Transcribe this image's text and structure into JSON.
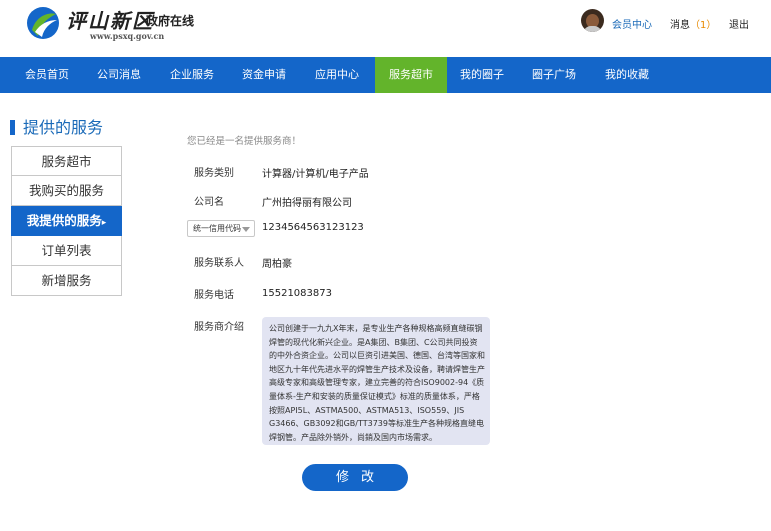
{
  "header": {
    "site_name": "评山新区",
    "site_sub": "政府在线",
    "site_url": "www.psxq.gov.cn",
    "member_center": "会员中心",
    "messages_label": "消息",
    "messages_count": "（1）",
    "logout": "退出"
  },
  "nav": {
    "items": [
      "会员首页",
      "公司消息",
      "企业服务",
      "资金申请",
      "应用中心",
      "服务超市",
      "我的圈子",
      "圈子广场",
      "我的收藏"
    ],
    "active_index": 5
  },
  "page_title": "提供的服务",
  "sidebar": {
    "items": [
      "服务超市",
      "我购买的服务",
      "我提供的服务",
      "订单列表",
      "新增服务"
    ],
    "active_arrow": "▸"
  },
  "form": {
    "notice": "您已经是一名提供服务商！",
    "category_label": "服务类别",
    "category_value": "计算器/计算机/电子产品",
    "company_label": "公司名",
    "company_value": "广州拍得丽有限公司",
    "code_select": "统一信用代码",
    "code_value": "1234564563123123",
    "contact_label": "服务联系人",
    "contact_value": "周柏豪",
    "phone_label": "服务电话",
    "phone_value": "15521083873",
    "intro_label": "服务商介绍",
    "intro_value": "公司创建于一九九X年末，是专业生产各种规格高频直缝碳钢焊管的现代化新兴企业。是A集团、B集团、C公司共同投资的中外合资企业。公司以巨资引进美国、德国、台湾等国家和地区九十年代先进水平的焊管生产技术及设备，聘请焊管生产高级专家和高级管理专家，建立完善的符合ISO9002-94《质量体系-生产和安装的质量保证模式》标准的质量体系，严格按照API5L、ASTMA500、ASTMA513、ISO559、JIS G3466、GB3092和GB/TT3739等标准生产各种规格直缝电焊钢管。产品除外销外，尚銷及国内市场需求。",
    "submit": "修改"
  },
  "colors": {
    "nav_blue": "#1466c9",
    "active_green": "#63b42b",
    "intro_bg": "#e2e4f2",
    "accent_orange": "#e88a00"
  }
}
